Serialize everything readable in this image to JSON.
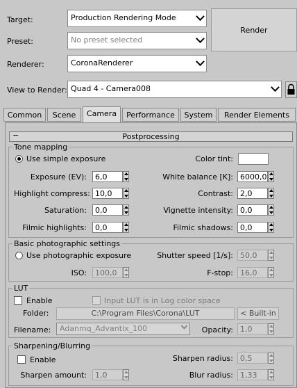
{
  "header": {
    "target_label": "Target:",
    "target_value": "Production Rendering Mode",
    "preset_label": "Preset:",
    "preset_value": "No preset selected",
    "renderer_label": "Renderer:",
    "renderer_value": "CoronaRenderer",
    "view_label": "View to Render:",
    "view_value": "Quad 4 - Camera008",
    "render_button": "Render"
  },
  "tabs": [
    "Common",
    "Scene",
    "Camera",
    "Performance",
    "System",
    "Render Elements"
  ],
  "active_tab": "Camera",
  "rollout_title": "Postprocessing",
  "rollout_toggle": "−",
  "tone_mapping": {
    "title": "Tone mapping",
    "simple_exposure_label": "Use simple exposure",
    "color_tint_label": "Color tint:",
    "color_tint_value": "#ffffff",
    "exposure_label": "Exposure (EV):",
    "exposure_value": "6,0",
    "white_balance_label": "White balance [K]:",
    "white_balance_value": "6000,0",
    "highlight_label": "Highlight compress:",
    "highlight_value": "10,0",
    "contrast_label": "Contrast:",
    "contrast_value": "2,0",
    "saturation_label": "Saturation:",
    "saturation_value": "0,0",
    "vignette_label": "Vignette intensity:",
    "vignette_value": "0,0",
    "filmic_high_label": "Filmic highlights:",
    "filmic_high_value": "0,0",
    "filmic_shadow_label": "Filmic shadows:",
    "filmic_shadow_value": "0,0"
  },
  "photographic": {
    "title": "Basic photographic settings",
    "photo_exposure_label": "Use photographic exposure",
    "shutter_label": "Shutter speed [1/s]:",
    "shutter_value": "50,0",
    "iso_label": "ISO:",
    "iso_value": "100,0",
    "fstop_label": "F-stop:",
    "fstop_value": "16,0"
  },
  "lut": {
    "title": "LUT",
    "enable_label": "Enable",
    "log_label": "Input LUT is in Log color space",
    "folder_label": "Folder:",
    "folder_value": "C:\\Program Files\\Corona\\LUT",
    "builtin_label": "< Built-in",
    "filename_label": "Filename:",
    "filename_value": "Adanmq_Advantix_100",
    "opacity_label": "Opacity:",
    "opacity_value": "1,0"
  },
  "sharpen": {
    "title": "Sharpening/Blurring",
    "enable_label": "Enable",
    "radius_label": "Sharpen radius:",
    "radius_value": "0,5",
    "amount_label": "Sharpen amount:",
    "amount_value": "1,0",
    "blur_label": "Blur radius:",
    "blur_value": "1,33"
  },
  "colors": {
    "background": "#c8c8c8",
    "field": "#ffffff",
    "disabled_field": "#d0d0d0"
  }
}
